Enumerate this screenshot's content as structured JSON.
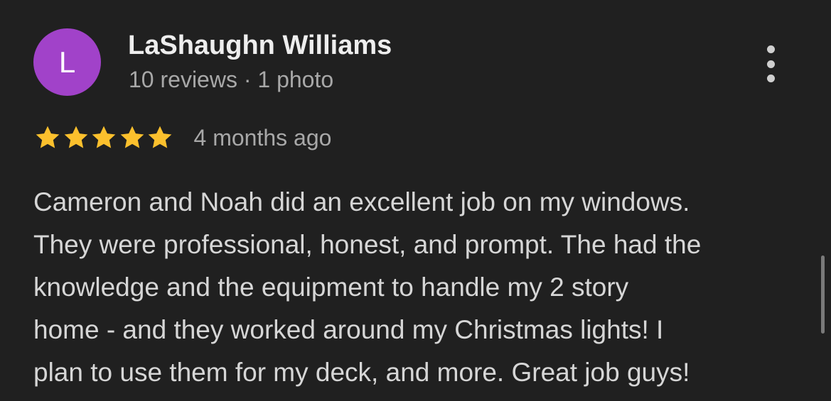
{
  "review": {
    "author": {
      "initial": "L",
      "name": "LaShaughn Williams",
      "meta": "10 reviews · 1 photo",
      "avatar_color": "#a142c9"
    },
    "rating": 5,
    "rating_max": 5,
    "star_color": "#fbc02d",
    "time_ago": "4 months ago",
    "text_lines": [
      "Cameron and Noah did an excellent job on my windows.",
      "They were professional, honest, and prompt. The had the",
      "knowledge and the equipment to handle my 2 story",
      "home - and they worked around my Christmas lights! I",
      "plan to use them for my deck, and more. Great job guys!"
    ],
    "more_icon": "more-vert-icon"
  }
}
